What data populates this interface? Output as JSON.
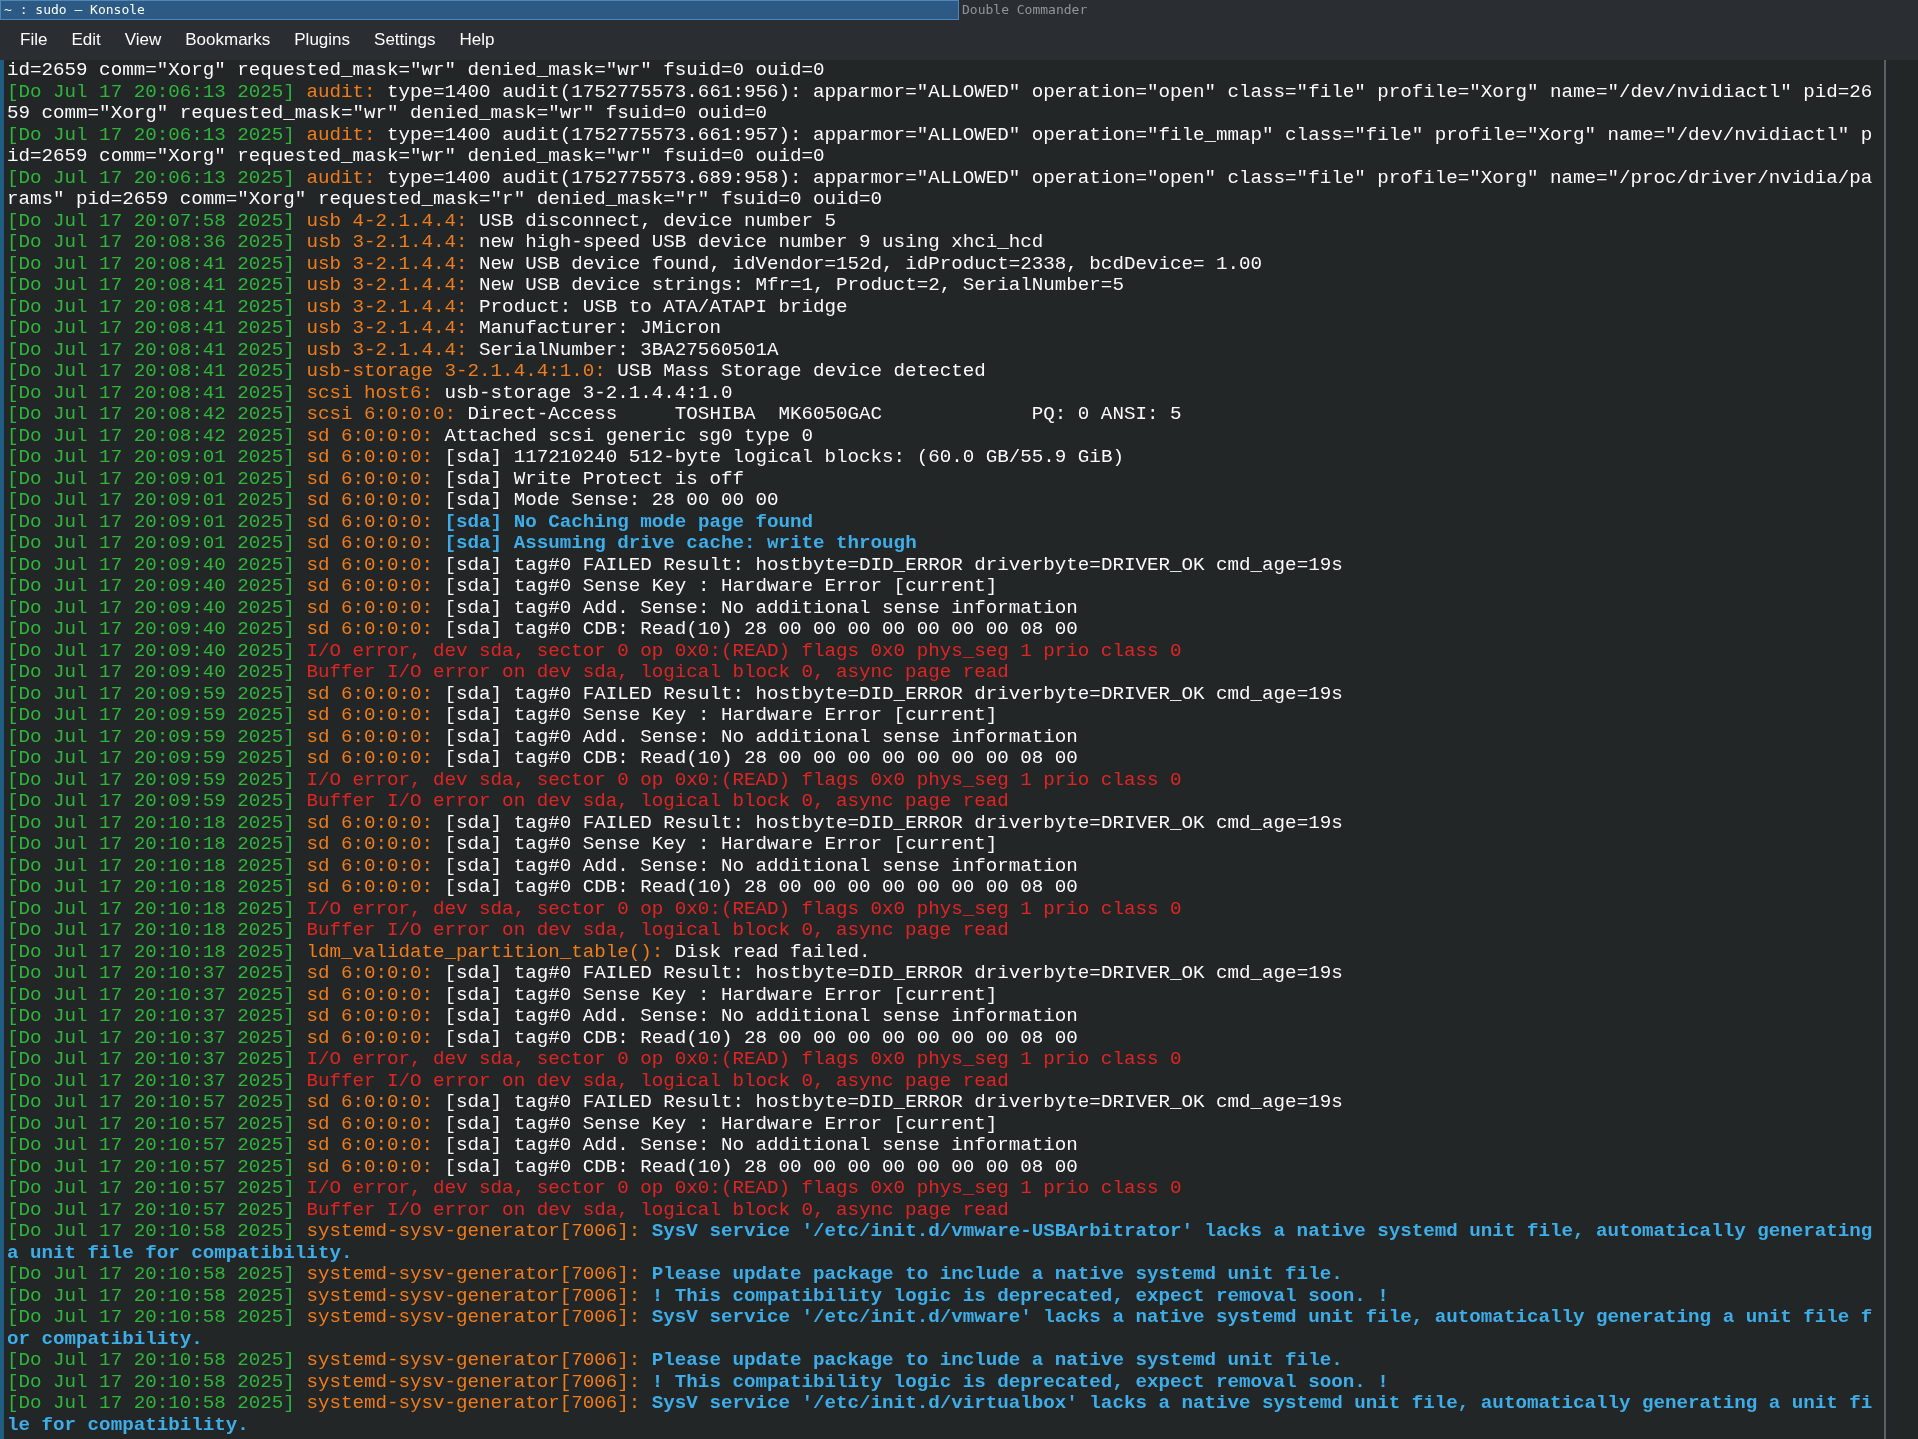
{
  "windows": [
    {
      "title": "~ : sudo — Konsole",
      "selected": true
    },
    {
      "title": "Double Commander",
      "selected": false
    }
  ],
  "menu": [
    "File",
    "Edit",
    "View",
    "Bookmarks",
    "Plugins",
    "Settings",
    "Help"
  ],
  "lines": [
    {
      "kind": "plain",
      "message": "id=2659 comm=\"Xorg\" requested_mask=\"wr\" denied_mask=\"wr\" fsuid=0 ouid=0"
    },
    {
      "kind": "plain",
      "time": "[Do Jul 17 20:06:13 2025]",
      "source": "audit:",
      "message": "type=1400 audit(1752775573.661:956): apparmor=\"ALLOWED\" operation=\"open\" class=\"file\" profile=\"Xorg\" name=\"/dev/nvidiactl\" pid=2659 comm=\"Xorg\" requested_mask=\"wr\" denied_mask=\"wr\" fsuid=0 ouid=0"
    },
    {
      "kind": "plain",
      "time": "[Do Jul 17 20:06:13 2025]",
      "source": "audit:",
      "message": "type=1400 audit(1752775573.661:957): apparmor=\"ALLOWED\" operation=\"file_mmap\" class=\"file\" profile=\"Xorg\" name=\"/dev/nvidiactl\" pid=2659 comm=\"Xorg\" requested_mask=\"wr\" denied_mask=\"wr\" fsuid=0 ouid=0"
    },
    {
      "kind": "plain",
      "time": "[Do Jul 17 20:06:13 2025]",
      "source": "audit:",
      "message": "type=1400 audit(1752775573.689:958): apparmor=\"ALLOWED\" operation=\"open\" class=\"file\" profile=\"Xorg\" name=\"/proc/driver/nvidia/params\" pid=2659 comm=\"Xorg\" requested_mask=\"r\" denied_mask=\"r\" fsuid=0 ouid=0"
    },
    {
      "kind": "plain",
      "time": "[Do Jul 17 20:07:58 2025]",
      "source": "usb 4-2.1.4.4:",
      "message": "USB disconnect, device number 5"
    },
    {
      "kind": "plain",
      "time": "[Do Jul 17 20:08:36 2025]",
      "source": "usb 3-2.1.4.4:",
      "message": "new high-speed USB device number 9 using xhci_hcd"
    },
    {
      "kind": "plain",
      "time": "[Do Jul 17 20:08:41 2025]",
      "source": "usb 3-2.1.4.4:",
      "message": "New USB device found, idVendor=152d, idProduct=2338, bcdDevice= 1.00"
    },
    {
      "kind": "plain",
      "time": "[Do Jul 17 20:08:41 2025]",
      "source": "usb 3-2.1.4.4:",
      "message": "New USB device strings: Mfr=1, Product=2, SerialNumber=5"
    },
    {
      "kind": "plain",
      "time": "[Do Jul 17 20:08:41 2025]",
      "source": "usb 3-2.1.4.4:",
      "message": "Product: USB to ATA/ATAPI bridge"
    },
    {
      "kind": "plain",
      "time": "[Do Jul 17 20:08:41 2025]",
      "source": "usb 3-2.1.4.4:",
      "message": "Manufacturer: JMicron"
    },
    {
      "kind": "plain",
      "time": "[Do Jul 17 20:08:41 2025]",
      "source": "usb 3-2.1.4.4:",
      "message": "SerialNumber: 3BA27560501A"
    },
    {
      "kind": "plain",
      "time": "[Do Jul 17 20:08:41 2025]",
      "source": "usb-storage 3-2.1.4.4:1.0:",
      "message": "USB Mass Storage device detected"
    },
    {
      "kind": "plain",
      "time": "[Do Jul 17 20:08:41 2025]",
      "source": "scsi host6:",
      "message": "usb-storage 3-2.1.4.4:1.0"
    },
    {
      "kind": "plain",
      "time": "[Do Jul 17 20:08:42 2025]",
      "source": "scsi 6:0:0:0:",
      "message": "Direct-Access     TOSHIBA  MK6050GAC             PQ: 0 ANSI: 5"
    },
    {
      "kind": "plain",
      "time": "[Do Jul 17 20:08:42 2025]",
      "source": "sd 6:0:0:0:",
      "message": "Attached scsi generic sg0 type 0"
    },
    {
      "kind": "plain",
      "time": "[Do Jul 17 20:09:01 2025]",
      "source": "sd 6:0:0:0:",
      "message": "[sda] 117210240 512-byte logical blocks: (60.0 GB/55.9 GiB)"
    },
    {
      "kind": "plain",
      "time": "[Do Jul 17 20:09:01 2025]",
      "source": "sd 6:0:0:0:",
      "message": "[sda] Write Protect is off"
    },
    {
      "kind": "plain",
      "time": "[Do Jul 17 20:09:01 2025]",
      "source": "sd 6:0:0:0:",
      "message": "[sda] Mode Sense: 28 00 00 00"
    },
    {
      "kind": "notice",
      "time": "[Do Jul 17 20:09:01 2025]",
      "source": "sd 6:0:0:0:",
      "message": "[sda] No Caching mode page found"
    },
    {
      "kind": "notice",
      "time": "[Do Jul 17 20:09:01 2025]",
      "source": "sd 6:0:0:0:",
      "message": "[sda] Assuming drive cache: write through"
    },
    {
      "kind": "plain",
      "time": "[Do Jul 17 20:09:40 2025]",
      "source": "sd 6:0:0:0:",
      "message": "[sda] tag#0 FAILED Result: hostbyte=DID_ERROR driverbyte=DRIVER_OK cmd_age=19s"
    },
    {
      "kind": "plain",
      "time": "[Do Jul 17 20:09:40 2025]",
      "source": "sd 6:0:0:0:",
      "message": "[sda] tag#0 Sense Key : Hardware Error [current]"
    },
    {
      "kind": "plain",
      "time": "[Do Jul 17 20:09:40 2025]",
      "source": "sd 6:0:0:0:",
      "message": "[sda] tag#0 Add. Sense: No additional sense information"
    },
    {
      "kind": "plain",
      "time": "[Do Jul 17 20:09:40 2025]",
      "source": "sd 6:0:0:0:",
      "message": "[sda] tag#0 CDB: Read(10) 28 00 00 00 00 00 00 00 08 00"
    },
    {
      "kind": "error",
      "time": "[Do Jul 17 20:09:40 2025]",
      "message": "I/O error, dev sda, sector 0 op 0x0:(READ) flags 0x0 phys_seg 1 prio class 0"
    },
    {
      "kind": "error",
      "time": "[Do Jul 17 20:09:40 2025]",
      "message": "Buffer I/O error on dev sda, logical block 0, async page read"
    },
    {
      "kind": "plain",
      "time": "[Do Jul 17 20:09:59 2025]",
      "source": "sd 6:0:0:0:",
      "message": "[sda] tag#0 FAILED Result: hostbyte=DID_ERROR driverbyte=DRIVER_OK cmd_age=19s"
    },
    {
      "kind": "plain",
      "time": "[Do Jul 17 20:09:59 2025]",
      "source": "sd 6:0:0:0:",
      "message": "[sda] tag#0 Sense Key : Hardware Error [current]"
    },
    {
      "kind": "plain",
      "time": "[Do Jul 17 20:09:59 2025]",
      "source": "sd 6:0:0:0:",
      "message": "[sda] tag#0 Add. Sense: No additional sense information"
    },
    {
      "kind": "plain",
      "time": "[Do Jul 17 20:09:59 2025]",
      "source": "sd 6:0:0:0:",
      "message": "[sda] tag#0 CDB: Read(10) 28 00 00 00 00 00 00 00 08 00"
    },
    {
      "kind": "error",
      "time": "[Do Jul 17 20:09:59 2025]",
      "message": "I/O error, dev sda, sector 0 op 0x0:(READ) flags 0x0 phys_seg 1 prio class 0"
    },
    {
      "kind": "error",
      "time": "[Do Jul 17 20:09:59 2025]",
      "message": "Buffer I/O error on dev sda, logical block 0, async page read"
    },
    {
      "kind": "plain",
      "time": "[Do Jul 17 20:10:18 2025]",
      "source": "sd 6:0:0:0:",
      "message": "[sda] tag#0 FAILED Result: hostbyte=DID_ERROR driverbyte=DRIVER_OK cmd_age=19s"
    },
    {
      "kind": "plain",
      "time": "[Do Jul 17 20:10:18 2025]",
      "source": "sd 6:0:0:0:",
      "message": "[sda] tag#0 Sense Key : Hardware Error [current]"
    },
    {
      "kind": "plain",
      "time": "[Do Jul 17 20:10:18 2025]",
      "source": "sd 6:0:0:0:",
      "message": "[sda] tag#0 Add. Sense: No additional sense information"
    },
    {
      "kind": "plain",
      "time": "[Do Jul 17 20:10:18 2025]",
      "source": "sd 6:0:0:0:",
      "message": "[sda] tag#0 CDB: Read(10) 28 00 00 00 00 00 00 00 08 00"
    },
    {
      "kind": "error",
      "time": "[Do Jul 17 20:10:18 2025]",
      "message": "I/O error, dev sda, sector 0 op 0x0:(READ) flags 0x0 phys_seg 1 prio class 0"
    },
    {
      "kind": "error",
      "time": "[Do Jul 17 20:10:18 2025]",
      "message": "Buffer I/O error on dev sda, logical block 0, async page read"
    },
    {
      "kind": "plain",
      "time": "[Do Jul 17 20:10:18 2025]",
      "source": "ldm_validate_partition_table():",
      "message": "Disk read failed."
    },
    {
      "kind": "plain",
      "time": "[Do Jul 17 20:10:37 2025]",
      "source": "sd 6:0:0:0:",
      "message": "[sda] tag#0 FAILED Result: hostbyte=DID_ERROR driverbyte=DRIVER_OK cmd_age=19s"
    },
    {
      "kind": "plain",
      "time": "[Do Jul 17 20:10:37 2025]",
      "source": "sd 6:0:0:0:",
      "message": "[sda] tag#0 Sense Key : Hardware Error [current]"
    },
    {
      "kind": "plain",
      "time": "[Do Jul 17 20:10:37 2025]",
      "source": "sd 6:0:0:0:",
      "message": "[sda] tag#0 Add. Sense: No additional sense information"
    },
    {
      "kind": "plain",
      "time": "[Do Jul 17 20:10:37 2025]",
      "source": "sd 6:0:0:0:",
      "message": "[sda] tag#0 CDB: Read(10) 28 00 00 00 00 00 00 00 08 00"
    },
    {
      "kind": "error",
      "time": "[Do Jul 17 20:10:37 2025]",
      "message": "I/O error, dev sda, sector 0 op 0x0:(READ) flags 0x0 phys_seg 1 prio class 0"
    },
    {
      "kind": "error",
      "time": "[Do Jul 17 20:10:37 2025]",
      "message": "Buffer I/O error on dev sda, logical block 0, async page read"
    },
    {
      "kind": "plain",
      "time": "[Do Jul 17 20:10:57 2025]",
      "source": "sd 6:0:0:0:",
      "message": "[sda] tag#0 FAILED Result: hostbyte=DID_ERROR driverbyte=DRIVER_OK cmd_age=19s"
    },
    {
      "kind": "plain",
      "time": "[Do Jul 17 20:10:57 2025]",
      "source": "sd 6:0:0:0:",
      "message": "[sda] tag#0 Sense Key : Hardware Error [current]"
    },
    {
      "kind": "plain",
      "time": "[Do Jul 17 20:10:57 2025]",
      "source": "sd 6:0:0:0:",
      "message": "[sda] tag#0 Add. Sense: No additional sense information"
    },
    {
      "kind": "plain",
      "time": "[Do Jul 17 20:10:57 2025]",
      "source": "sd 6:0:0:0:",
      "message": "[sda] tag#0 CDB: Read(10) 28 00 00 00 00 00 00 00 08 00"
    },
    {
      "kind": "error",
      "time": "[Do Jul 17 20:10:57 2025]",
      "message": "I/O error, dev sda, sector 0 op 0x0:(READ) flags 0x0 phys_seg 1 prio class 0"
    },
    {
      "kind": "error",
      "time": "[Do Jul 17 20:10:57 2025]",
      "message": "Buffer I/O error on dev sda, logical block 0, async page read"
    },
    {
      "kind": "notice",
      "time": "[Do Jul 17 20:10:58 2025]",
      "source": "systemd-sysv-generator[7006]:",
      "message": "SysV service '/etc/init.d/vmware-USBArbitrator' lacks a native systemd unit file, automatically generating a unit file for compatibility."
    },
    {
      "kind": "notice",
      "time": "[Do Jul 17 20:10:58 2025]",
      "source": "systemd-sysv-generator[7006]:",
      "message": "Please update package to include a native systemd unit file."
    },
    {
      "kind": "notice",
      "time": "[Do Jul 17 20:10:58 2025]",
      "source": "systemd-sysv-generator[7006]:",
      "message": "! This compatibility logic is deprecated, expect removal soon. !"
    },
    {
      "kind": "notice",
      "time": "[Do Jul 17 20:10:58 2025]",
      "source": "systemd-sysv-generator[7006]:",
      "message": "SysV service '/etc/init.d/vmware' lacks a native systemd unit file, automatically generating a unit file for compatibility."
    },
    {
      "kind": "notice",
      "time": "[Do Jul 17 20:10:58 2025]",
      "source": "systemd-sysv-generator[7006]:",
      "message": "Please update package to include a native systemd unit file."
    },
    {
      "kind": "notice",
      "time": "[Do Jul 17 20:10:58 2025]",
      "source": "systemd-sysv-generator[7006]:",
      "message": "! This compatibility logic is deprecated, expect removal soon. !"
    },
    {
      "kind": "notice",
      "time": "[Do Jul 17 20:10:58 2025]",
      "source": "systemd-sysv-generator[7006]:",
      "message": "SysV service '/etc/init.d/virtualbox' lacks a native systemd unit file, automatically generating a unit file for compatibility."
    }
  ]
}
